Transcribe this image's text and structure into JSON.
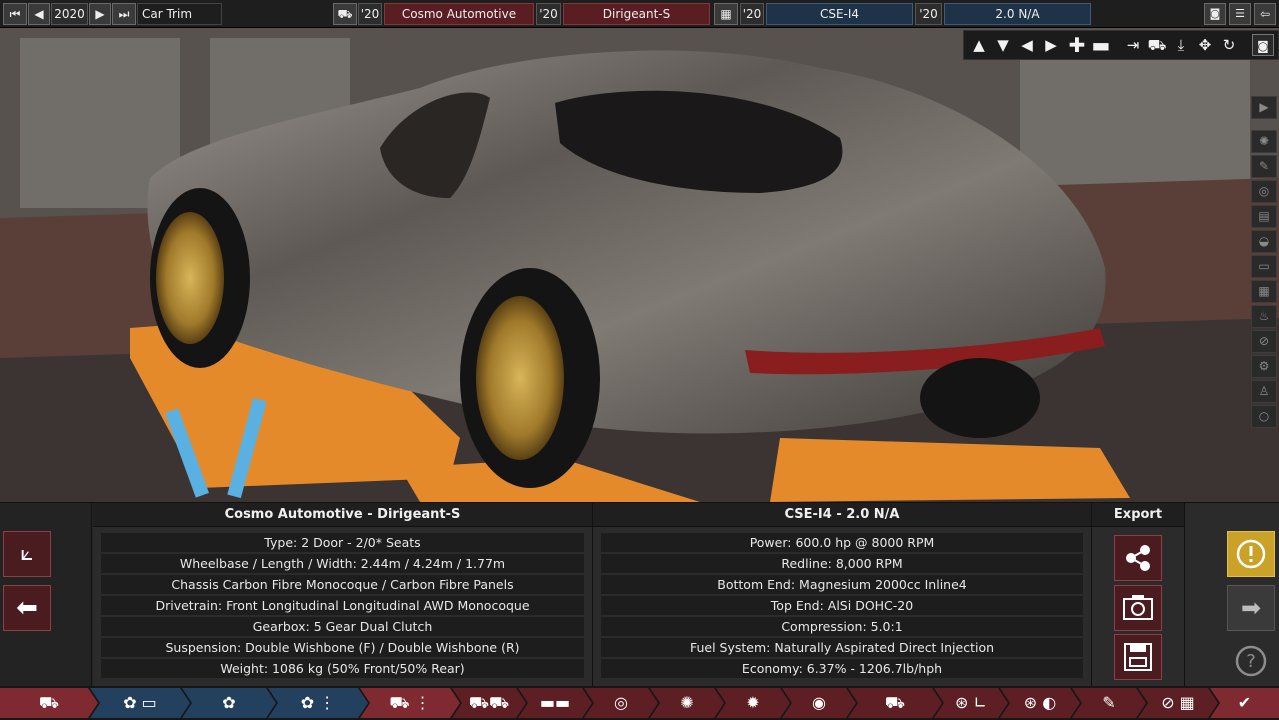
{
  "topbar": {
    "year": "2020",
    "year_caption": "Car Trim year",
    "model_year_1": "'20",
    "manufacturer": "Cosmo Automotive",
    "model_year_2": "'20",
    "model": "Dirigeant-S",
    "engine_year_1": "'20",
    "engine_family": "CSE-I4",
    "engine_year_2": "'20",
    "engine_variant": "2.0 N/A"
  },
  "car_panel": {
    "header": "Cosmo Automotive - Dirigeant-S",
    "rows": [
      "Type: 2 Door - 2/0* Seats",
      "Wheelbase / Length / Width: 2.44m / 4.24m / 1.77m",
      "Chassis Carbon Fibre Monocoque / Carbon Fibre Panels",
      "Drivetrain: Front Longitudinal Longitudinal AWD Monocoque",
      "Gearbox: 5 Gear Dual Clutch",
      "Suspension: Double Wishbone (F) / Double Wishbone (R)",
      "Weight: 1086 kg (50% Front/50% Rear)"
    ]
  },
  "engine_panel": {
    "header": "CSE-I4 - 2.0 N/A",
    "rows": [
      "Power: 600.0 hp @ 8000 RPM",
      "Redline:  8,000 RPM",
      "Bottom End: Magnesium 2000cc Inline4",
      "Top End: AlSi DOHC-20",
      "Compression: 5.0:1",
      "Fuel System: Naturally Aspirated Direct Injection",
      "Economy: 6.37% - 1206.7lb/hph"
    ]
  },
  "export_panel": {
    "header": "Export"
  },
  "colors": {
    "accent_red": "#7e2a30",
    "accent_blue": "#23405f",
    "warning": "#c9a227"
  }
}
